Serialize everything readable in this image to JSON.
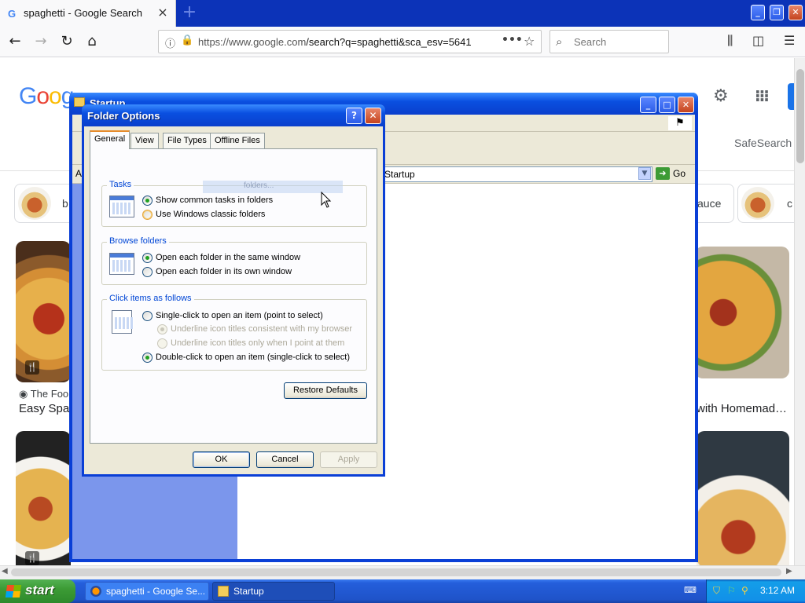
{
  "browser": {
    "tab_title": "spaghetti - Google Search",
    "tab_favicon": "G",
    "url_base": "https://www.google.com",
    "url_path": "/search?q=spaghetti&sca_esv=5641",
    "search_placeholder": "Search"
  },
  "google": {
    "safesearch_label": "SafeSearch",
    "chips": [
      {
        "label": "b"
      },
      {
        "label": "auce"
      },
      {
        "label": "c"
      }
    ],
    "results": [
      {
        "source": "The Foo",
        "title": "Easy Spag"
      },
      {
        "source": "",
        "title": "with Homemad…"
      }
    ]
  },
  "explorer": {
    "title": "Startup",
    "address": "Startup",
    "go_label": "Go",
    "address_label": "A"
  },
  "dialog": {
    "title": "Folder Options",
    "tabs": [
      "General",
      "View",
      "File Types",
      "Offline Files"
    ],
    "groups": {
      "tasks": {
        "title": "Tasks",
        "options": [
          "Show common tasks in folders",
          "Use Windows classic folders"
        ]
      },
      "browse": {
        "title": "Browse folders",
        "options": [
          "Open each folder in the same window",
          "Open each folder in its own window"
        ]
      },
      "click": {
        "title": "Click items as follows",
        "options": [
          "Single-click to open an item (point to select)",
          "Underline icon titles consistent with my browser",
          "Underline icon titles only when I point at them",
          "Double-click to open an item (single-click to select)"
        ]
      }
    },
    "restore_label": "Restore Defaults",
    "ok_label": "OK",
    "cancel_label": "Cancel",
    "apply_label": "Apply",
    "drag_ghost_text": "folders..."
  },
  "taskbar": {
    "start_label": "start",
    "items": [
      {
        "label": "spaghetti - Google Se..."
      },
      {
        "label": "Startup"
      }
    ],
    "clock": "3:12 AM"
  },
  "colors": {
    "xp_blue": "#0a3fd6",
    "start_green": "#3c9b35",
    "google_blue": "#4285f4"
  }
}
